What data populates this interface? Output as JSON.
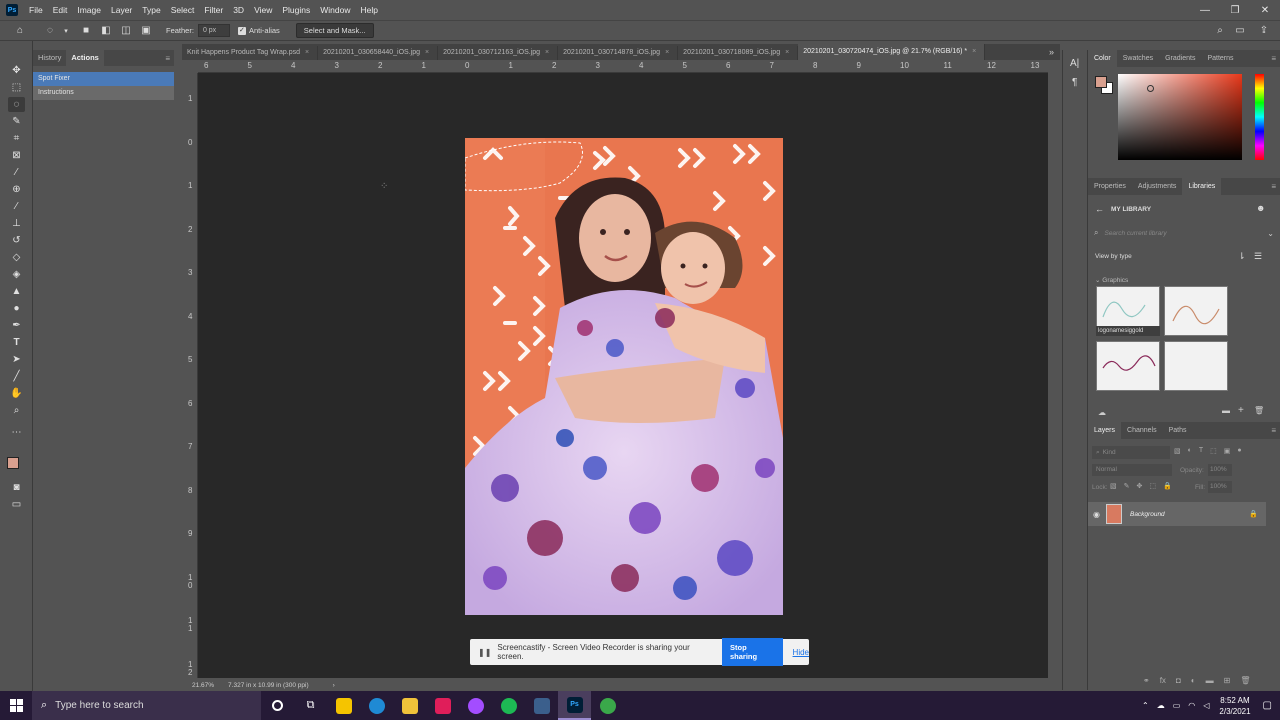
{
  "app": {
    "logo": "Ps"
  },
  "menu": [
    "File",
    "Edit",
    "Image",
    "Layer",
    "Type",
    "Select",
    "Filter",
    "3D",
    "View",
    "Plugins",
    "Window",
    "Help"
  ],
  "options": {
    "feather_label": "Feather:",
    "feather_value": "0 px",
    "antialias": "Anti-alias",
    "select_mask": "Select and Mask..."
  },
  "left_panel": {
    "tabs": [
      "History",
      "Actions"
    ],
    "actions": [
      "Spot Fixer",
      "Instructions"
    ]
  },
  "doc_tabs": [
    "Knit Happens Product Tag Wrap.psd",
    "20210201_030658440_iOS.jpg",
    "20210201_030712163_iOS.jpg",
    "20210201_030714878_iOS.jpg",
    "20210201_030718089_iOS.jpg",
    "20210201_030720474_iOS.jpg @ 21.7% (RGB/16) *"
  ],
  "ruler_top": [
    "6",
    "5",
    "4",
    "3",
    "2",
    "1",
    "0",
    "1",
    "2",
    "3",
    "4",
    "5",
    "6",
    "7",
    "8",
    "9",
    "10",
    "11",
    "12",
    "13"
  ],
  "ruler_left": [
    "1",
    "0",
    "1",
    "2",
    "3",
    "4",
    "5",
    "6",
    "7",
    "8",
    "9",
    "1 0",
    "1 1",
    "1 2"
  ],
  "status": {
    "zoom": "21.67%",
    "doc_info": "7.327 in x 10.99 in (300 ppi)",
    "arrow": "›"
  },
  "share_bar": {
    "message": "Screencastify - Screen Video Recorder is sharing your screen.",
    "stop": "Stop sharing",
    "hide": "Hide"
  },
  "color_panel": {
    "tabs": [
      "Color",
      "Swatches",
      "Gradients",
      "Patterns"
    ],
    "fg_color": "#d9a08f",
    "bg_color": "#ffffff"
  },
  "libraries_panel": {
    "tabs": [
      "Properties",
      "Adjustments",
      "Libraries"
    ],
    "library_name": "MY LIBRARY",
    "search_placeholder": "Search current library",
    "view_by": "View by type",
    "graphics_label": "Graphics",
    "thumb_caption": "logonamesiggold"
  },
  "layers_panel": {
    "tabs": [
      "Layers",
      "Channels",
      "Paths"
    ],
    "kind": "Kind",
    "blend_mode": "Normal",
    "opacity_label": "Opacity:",
    "opacity_value": "100%",
    "lock_label": "Lock:",
    "fill_label": "Fill:",
    "fill_value": "100%",
    "layer_name": "Background"
  },
  "taskbar": {
    "search_placeholder": "Type here to search",
    "time": "8:52 AM",
    "date": "2/3/2021"
  }
}
